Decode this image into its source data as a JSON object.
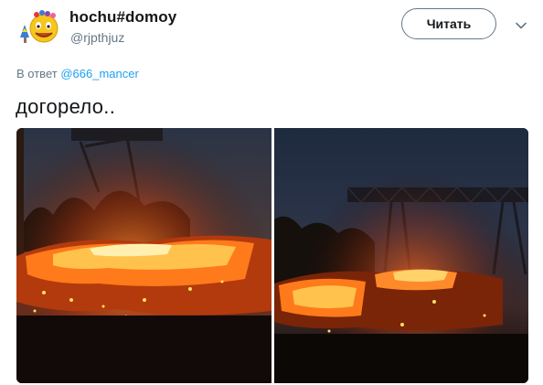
{
  "author": {
    "name": "hochu#domoy",
    "handle": "@rjpthjuz"
  },
  "follow_button": {
    "label": "Читать"
  },
  "menu_icon": "chevron-down-icon",
  "reply_context": {
    "prefix": "В ответ",
    "mention": "@666_mancer"
  },
  "tweet": {
    "text": "догорело.."
  },
  "colors": {
    "text": "#14171a",
    "secondary": "#657786",
    "link": "#1da1f2",
    "fire": "#ff7a1a"
  }
}
